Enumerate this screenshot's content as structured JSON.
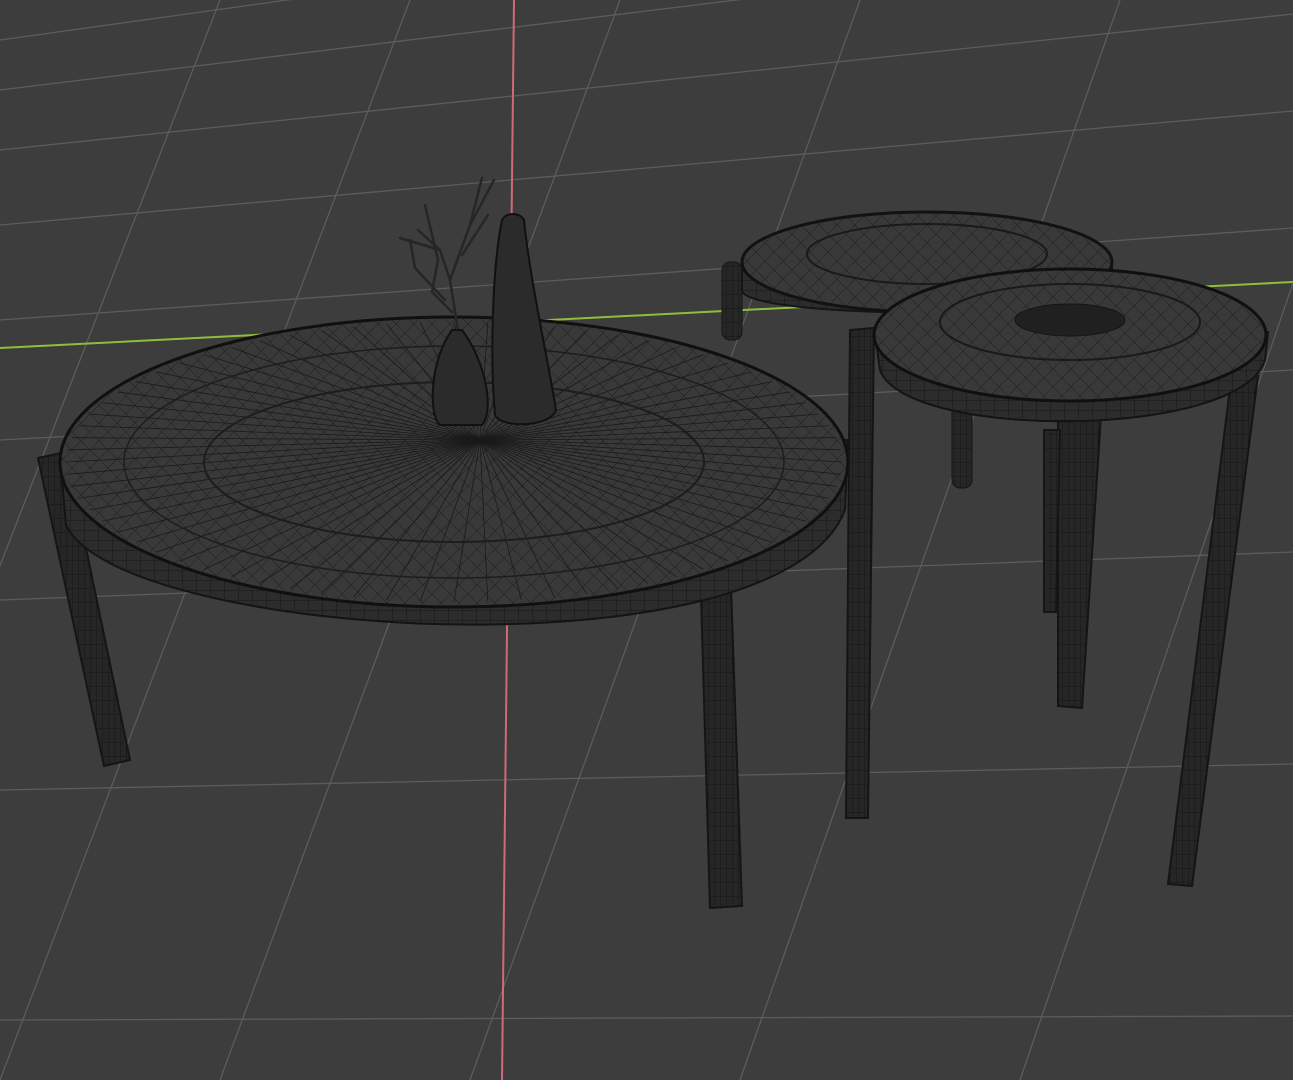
{
  "viewport": {
    "type": "3D viewport",
    "shading": "wireframe",
    "background_color": "#3d3d3d",
    "grid_color": "#5c5c5c",
    "x_axis_color": "#d06a78",
    "y_axis_color": "#8fbf3a",
    "mesh_fill_color": "#2a2a2a",
    "wire_color": "#141414"
  },
  "scene": {
    "objects": [
      "large-round-coffee-table",
      "small-side-table-back",
      "small-side-table-front",
      "tall-vase",
      "short-vase",
      "dry-branch"
    ]
  }
}
